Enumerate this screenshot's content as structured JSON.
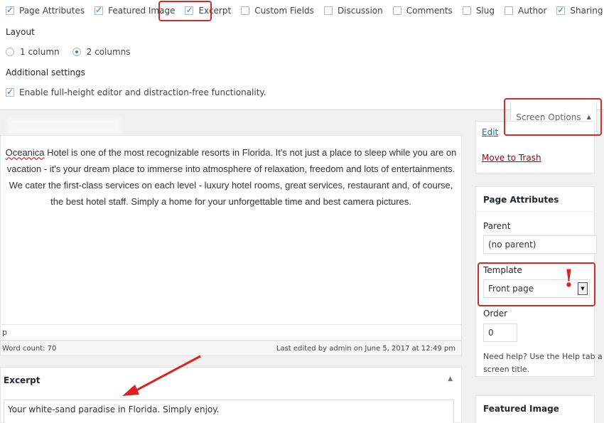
{
  "screen_options": {
    "checkboxes": [
      {
        "label": "Page Attributes",
        "checked": true
      },
      {
        "label": "Featured Image",
        "checked": true
      },
      {
        "label": "Excerpt",
        "checked": true
      },
      {
        "label": "Custom Fields",
        "checked": false
      },
      {
        "label": "Discussion",
        "checked": false
      },
      {
        "label": "Comments",
        "checked": false
      },
      {
        "label": "Slug",
        "checked": false
      },
      {
        "label": "Author",
        "checked": false
      },
      {
        "label": "Sharing",
        "checked": true
      }
    ],
    "layout_label": "Layout",
    "layout_options": [
      {
        "label": "1 column",
        "checked": false
      },
      {
        "label": "2 columns",
        "checked": true
      }
    ],
    "additional_label": "Additional settings",
    "fullheight_label": "Enable full-height editor and distraction-free functionality.",
    "fullheight_checked": true,
    "tab_label": "Screen Options"
  },
  "editor": {
    "content_link_word": "Oceanica",
    "content_rest": " Hotel is one of the most recognizable resorts in Florida. It's not just a place to sleep while you are on vacation - it's your dream place to immerse into atmosphere of relaxation, freedom and lots of entertainments. We cater the first-class services on each level - luxury hotel rooms, great services, restaurant and, of course, the best hotel staff. Simply a home for your unforgettable time and best camera pictures.",
    "path": "p",
    "word_count": "Word count: 70",
    "last_edited": "Last edited by admin on June 5, 2017 at 12:49 pm"
  },
  "excerpt": {
    "title": "Excerpt",
    "text": "Your white-sand paradise in Florida. Simply enjoy."
  },
  "sidebar": {
    "edit_link": "Edit",
    "trash_link": "Move to Trash",
    "page_attributes": {
      "title": "Page Attributes",
      "parent_label": "Parent",
      "parent_value": "(no parent)",
      "template_label": "Template",
      "template_value": "Front page",
      "order_label": "Order",
      "order_value": "0",
      "help_text": "Need help? Use the Help tab a screen title."
    },
    "featured_image_title": "Featured Image"
  },
  "annotations": {
    "exclamation": "!",
    "highlight_color": "#d62a2a"
  }
}
